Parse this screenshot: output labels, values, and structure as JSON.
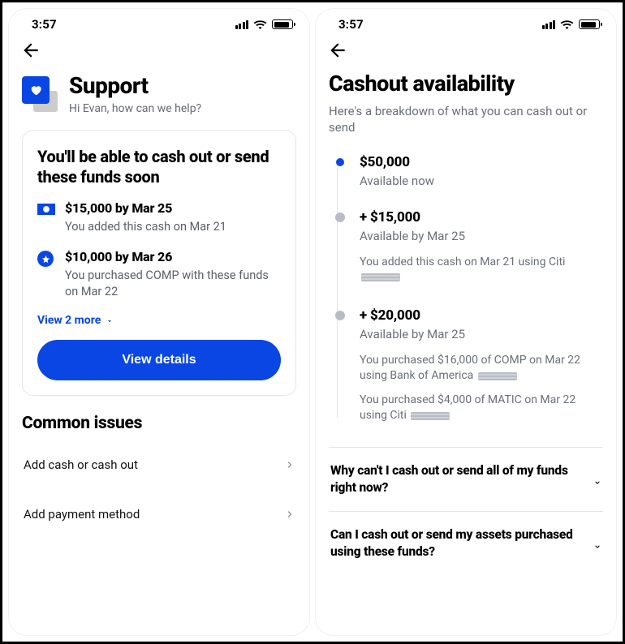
{
  "status": {
    "time": "3:57"
  },
  "left": {
    "header": {
      "title": "Support",
      "greeting": "Hi Evan, how can we help?"
    },
    "card": {
      "headline": "You'll be able to cash out or send these funds soon",
      "items": [
        {
          "amount": "$15,000 by Mar 25",
          "desc": "You added this cash on Mar 21",
          "icon": "cash"
        },
        {
          "amount": "$10,000 by Mar 26",
          "desc": "You purchased COMP with these funds on Mar 22",
          "icon": "star"
        }
      ],
      "view_more": "View 2 more",
      "cta": "View details"
    },
    "issues": {
      "title": "Common issues",
      "items": [
        {
          "label": "Add cash or cash out"
        },
        {
          "label": "Add payment method"
        }
      ]
    }
  },
  "right": {
    "title": "Cashout availability",
    "subtitle": "Here's a breakdown of what you can cash out or send",
    "timeline": [
      {
        "amount": "$50,000",
        "label": "Available now",
        "active": true
      },
      {
        "amount": "+ $15,000",
        "label": "Available by Mar 25",
        "notes": [
          "You added this cash on Mar 21 using Citi"
        ],
        "redacted": [
          true
        ]
      },
      {
        "amount": "+ $20,000",
        "label": "Available by Mar 25",
        "notes": [
          "You purchased $16,000 of COMP on Mar 22  using Bank of America",
          "You purchased $4,000 of MATIC on Mar 22 using Citi"
        ],
        "redacted": [
          true,
          true
        ]
      }
    ],
    "faq": [
      {
        "q": "Why can't I cash out or send all of my funds right now?"
      },
      {
        "q": "Can I cash out or send my assets purchased using these funds?"
      }
    ]
  }
}
